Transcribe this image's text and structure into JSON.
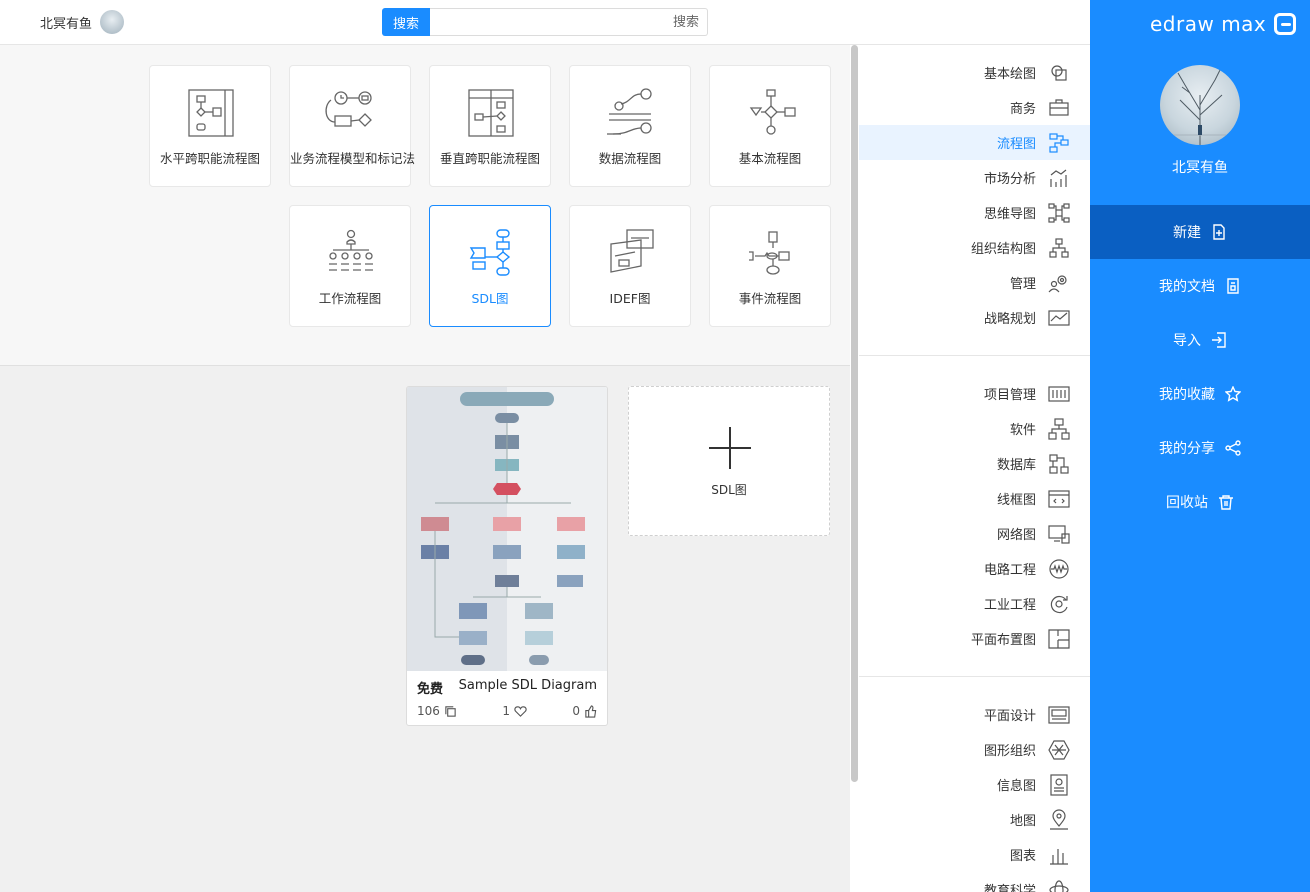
{
  "app": {
    "logo_text": "edraw max"
  },
  "user": {
    "name": "北冥有鱼"
  },
  "topbar": {
    "user_name": "北冥有鱼",
    "search_button": "搜索",
    "search_placeholder": "搜索"
  },
  "sidebar": {
    "items": [
      {
        "label": "新建",
        "icon": "new-file-icon",
        "active": true
      },
      {
        "label": "我的文档",
        "icon": "document-icon",
        "active": false
      },
      {
        "label": "导入",
        "icon": "import-icon",
        "active": false
      },
      {
        "label": "我的收藏",
        "icon": "star-icon",
        "active": false
      },
      {
        "label": "我的分享",
        "icon": "share-icon",
        "active": false
      },
      {
        "label": "回收站",
        "icon": "trash-icon",
        "active": false
      }
    ]
  },
  "categories": {
    "group1": [
      {
        "label": "基本绘图",
        "icon": "shapes-icon"
      },
      {
        "label": "商务",
        "icon": "briefcase-icon"
      },
      {
        "label": "流程图",
        "icon": "flowchart-icon",
        "active": true
      },
      {
        "label": "市场分析",
        "icon": "bar-chart-icon"
      },
      {
        "label": "思维导图",
        "icon": "mindmap-icon"
      },
      {
        "label": "组织结构图",
        "icon": "org-chart-icon"
      },
      {
        "label": "管理",
        "icon": "gear-people-icon"
      },
      {
        "label": "战略规划",
        "icon": "strategy-icon"
      }
    ],
    "group2": [
      {
        "label": "项目管理",
        "icon": "project-icon"
      },
      {
        "label": "软件",
        "icon": "software-icon"
      },
      {
        "label": "数据库",
        "icon": "database-icon"
      },
      {
        "label": "线框图",
        "icon": "wireframe-icon"
      },
      {
        "label": "网络图",
        "icon": "network-icon"
      },
      {
        "label": "电路工程",
        "icon": "circuit-icon"
      },
      {
        "label": "工业工程",
        "icon": "industrial-icon"
      },
      {
        "label": "平面布置图",
        "icon": "floorplan-icon"
      }
    ],
    "group3": [
      {
        "label": "平面设计",
        "icon": "design-icon"
      },
      {
        "label": "图形组织",
        "icon": "graphic-org-icon"
      },
      {
        "label": "信息图",
        "icon": "infographic-icon"
      },
      {
        "label": "地图",
        "icon": "map-pin-icon"
      },
      {
        "label": "图表",
        "icon": "chart-icon"
      },
      {
        "label": "教育科学",
        "icon": "science-icon"
      }
    ]
  },
  "templates": [
    {
      "label": "基本流程图",
      "icon": "basic-flowchart-icon"
    },
    {
      "label": "数据流程图",
      "icon": "data-flow-icon"
    },
    {
      "label": "垂直跨职能流程图",
      "icon": "vertical-swimlane-icon"
    },
    {
      "label": "业务流程模型和标记法",
      "icon": "bpmn-icon"
    },
    {
      "label": "水平跨职能流程图",
      "icon": "horizontal-swimlane-icon"
    },
    {
      "label": "事件流程图",
      "icon": "event-flow-icon"
    },
    {
      "label": "IDEF图",
      "icon": "idef-icon"
    },
    {
      "label": "SDL图",
      "icon": "sdl-icon",
      "selected": true
    },
    {
      "label": "工作流程图",
      "icon": "workflow-icon"
    }
  ],
  "new_card": {
    "label": "SDL图"
  },
  "file": {
    "title": "Sample SDL Diagram",
    "price": "免费",
    "likes": "0",
    "favorites": "1",
    "copies": "106"
  }
}
